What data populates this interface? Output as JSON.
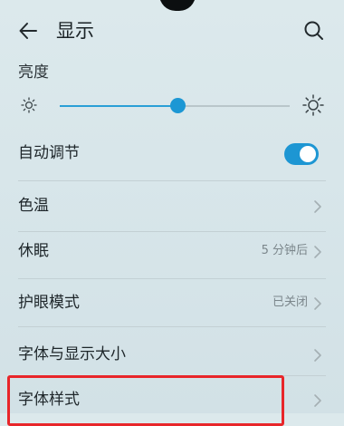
{
  "header": {
    "title": "显示",
    "back_icon": "back-arrow-icon",
    "search_icon": "search-icon"
  },
  "brightness": {
    "section_label": "亮度",
    "level": 0.51,
    "accent": "#1c97d4"
  },
  "settings": {
    "auto_adjust": {
      "label": "自动调节",
      "enabled": true
    },
    "color_temp": {
      "label": "色温"
    },
    "sleep": {
      "label": "休眠",
      "value": "5 分钟后"
    },
    "eye_comfort": {
      "label": "护眼模式",
      "value": "已关闭"
    },
    "font_display_size": {
      "label": "字体与显示大小"
    },
    "font_style": {
      "label": "字体样式",
      "highlighted": true,
      "highlight_color": "#e8262a"
    }
  }
}
